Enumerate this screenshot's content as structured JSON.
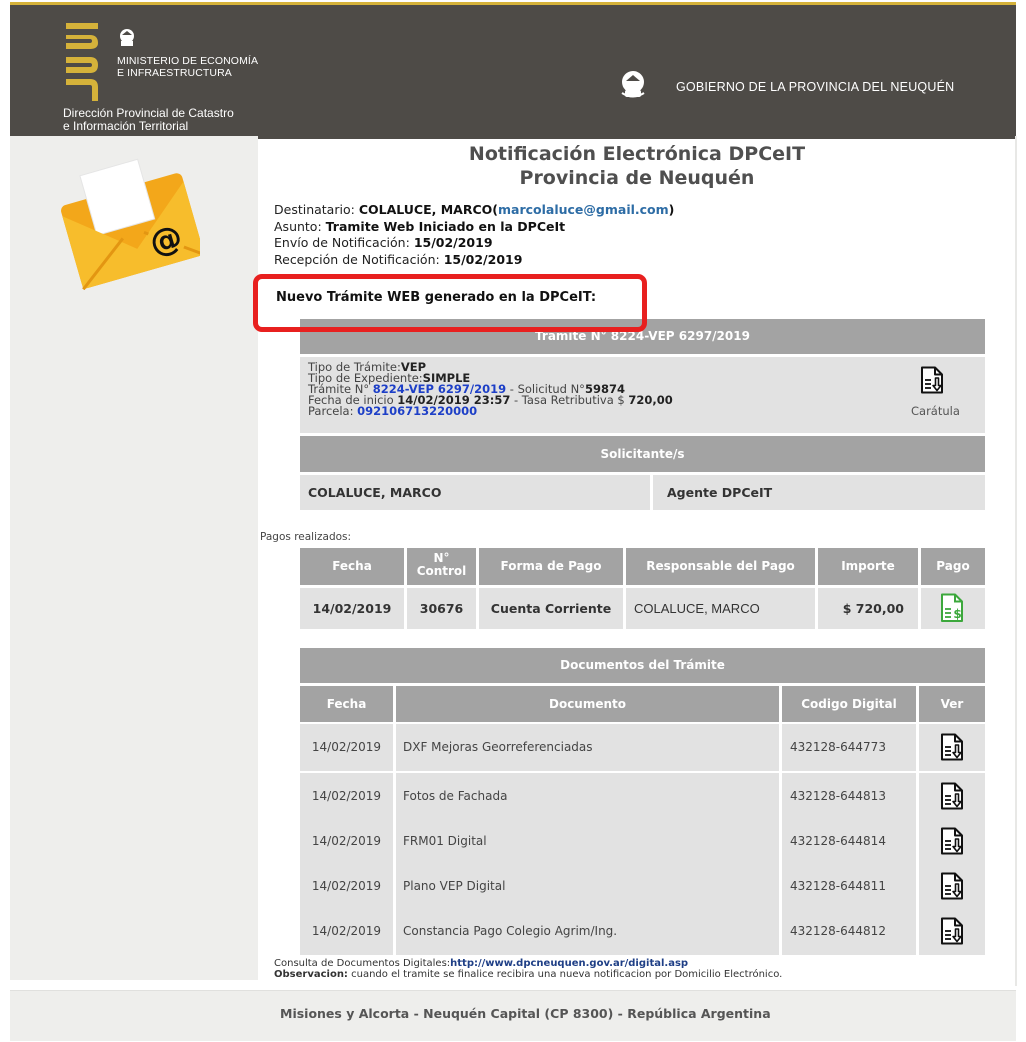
{
  "header": {
    "brand_logo": "neu",
    "ministry_line1": "MINISTERIO DE ECONOMÍA",
    "ministry_line2": "E INFRAESTRUCTURA",
    "dept_line1": "Dirección Provincial de Catastro",
    "dept_line2": "e Información Territorial",
    "gov_name": "GOBIERNO DE LA PROVINCIA DEL NEUQUÉN",
    "brand_color": "#d5b23a",
    "header_bg": "#4e4b47"
  },
  "title": {
    "line1": "Notificación Electrónica DPCeIT",
    "line2": "Provincia de Neuquén"
  },
  "info": {
    "destinatario_label": "Destinatario:",
    "destinatario_name": "COLALUCE, MARCO",
    "destinatario_email": "marcolaluce@gmail.com",
    "asunto_label": "Asunto:",
    "asunto_value": "Tramite Web Iniciado en la DPCeIt",
    "envio_label": "Envío de Notificación:",
    "envio_value": "15/02/2019",
    "recepcion_label": "Recepción de Notificación:",
    "recepcion_value": "15/02/2019"
  },
  "new_tramite_title": "Nuevo Trámite WEB generado en la DPCeIT:",
  "tramite": {
    "header": "Trámite N° 8224-VEP 6297/2019",
    "tipo_label": "Tipo de Trámite:",
    "tipo_value": "VEP",
    "expediente_label": "Tipo de Expediente:",
    "expediente_value": "SIMPLE",
    "numero_label": "Trámite N°",
    "numero_value": "8224-VEP 6297/2019",
    "solicitud_label": "- Solicitud N°",
    "solicitud_value": "59874",
    "fecha_label": "Fecha de inicio",
    "fecha_value": "14/02/2019 23:57",
    "tasa_label": "- Tasa Retributiva $",
    "tasa_value": "720,00",
    "parcela_label": "Parcela:",
    "parcela_value": "092106713220000",
    "caratula_label": "Carátula",
    "caratula_icon": "document-download-icon"
  },
  "solicitantes": {
    "header": "Solicitante/s",
    "name": "COLALUCE, MARCO",
    "role": "Agente DPCeIT"
  },
  "pagos": {
    "label": "Pagos realizados:",
    "columns": [
      "Fecha",
      "N°",
      "Control",
      "Forma de Pago",
      "Responsable del Pago",
      "Importe",
      "Pago"
    ],
    "row": {
      "fecha": "14/02/2019",
      "control": "30676",
      "forma": "Cuenta Corriente",
      "responsable": "COLALUCE, MARCO",
      "importe": "$ 720,00",
      "pago_icon": "payment-document-icon",
      "pago_icon_color": "#3ca83c"
    }
  },
  "documentos": {
    "header": "Documentos del Trámite",
    "columns": [
      "Fecha",
      "Documento",
      "Codigo Digital",
      "Ver"
    ],
    "rows": [
      {
        "fecha": "14/02/2019",
        "documento": "DXF Mejoras Georreferenciadas",
        "codigo": "432128-644773"
      },
      {
        "fecha": "14/02/2019",
        "documento": "Fotos de Fachada",
        "codigo": "432128-644813"
      },
      {
        "fecha": "14/02/2019",
        "documento": "FRM01 Digital",
        "codigo": "432128-644814"
      },
      {
        "fecha": "14/02/2019",
        "documento": "Plano VEP Digital",
        "codigo": "432128-644811"
      },
      {
        "fecha": "14/02/2019",
        "documento": "Constancia Pago Colegio Agrim/Ing.",
        "codigo": "432128-644812"
      }
    ]
  },
  "notes": {
    "consulta_label": "Consulta de Documentos Digitales:",
    "consulta_url": "http://www.dpcneuquen.gov.ar/digital.asp",
    "obs_label": "Observacion:",
    "obs_text": "cuando el tramite se finalice recibira una nueva notificacion por Domicilio Electrónico."
  },
  "footer": {
    "address": "Misiones y Alcorta - Neuquén Capital (CP 8300) - República Argentina"
  },
  "highlight_color": "#e8201f"
}
